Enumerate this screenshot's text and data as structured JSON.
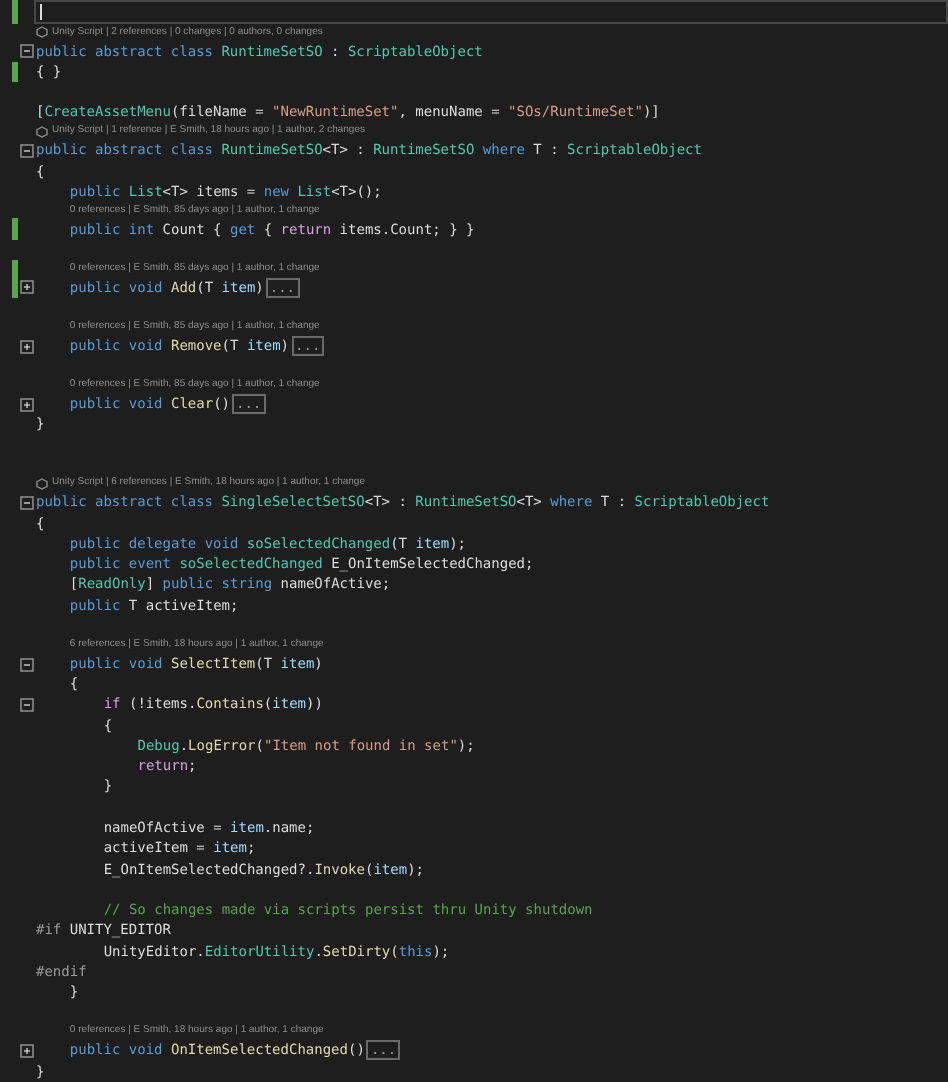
{
  "editor": {
    "lines": [
      {
        "kind": "cursor",
        "changed": true
      },
      {
        "kind": "lens",
        "unity_icon": true,
        "text": "Unity Script | 2 references | 0 changes | 0 authors, 0 changes"
      },
      {
        "kind": "code",
        "fold_marker": true,
        "expanded": true,
        "tokens": [
          {
            "text": "public abstract class ",
            "kind": "kw"
          },
          {
            "text": "RuntimeSetSO",
            "kind": "type"
          },
          {
            "text": " : ",
            "kind": "plain"
          },
          {
            "text": "ScriptableObject",
            "kind": "type"
          }
        ]
      },
      {
        "kind": "code",
        "changed": true,
        "tokens": [
          {
            "text": "{ }",
            "kind": "plain"
          }
        ]
      },
      {
        "kind": "blank"
      },
      {
        "kind": "code",
        "tokens": [
          {
            "text": "[",
            "kind": "plain"
          },
          {
            "text": "CreateAssetMenu",
            "kind": "type"
          },
          {
            "text": "(fileName = ",
            "kind": "plain"
          },
          {
            "text": "\"NewRuntimeSet\"",
            "kind": "str"
          },
          {
            "text": ", menuName = ",
            "kind": "plain"
          },
          {
            "text": "\"SOs/RuntimeSet\"",
            "kind": "str"
          },
          {
            "text": ")]",
            "kind": "plain"
          }
        ]
      },
      {
        "kind": "lens",
        "unity_icon": true,
        "text": "Unity Script | 1 reference | E Smith, 18 hours ago | 1 author, 2 changes"
      },
      {
        "kind": "code",
        "fold_marker": true,
        "expanded": true,
        "tokens": [
          {
            "text": "public abstract class ",
            "kind": "kw"
          },
          {
            "text": "RuntimeSetSO",
            "kind": "type"
          },
          {
            "text": "<T> : ",
            "kind": "plain"
          },
          {
            "text": "RuntimeSetSO",
            "kind": "type"
          },
          {
            "text": " where",
            "kind": "kw"
          },
          {
            "text": " T : ",
            "kind": "plain"
          },
          {
            "text": "ScriptableObject",
            "kind": "type"
          }
        ]
      },
      {
        "kind": "code",
        "tokens": [
          {
            "text": "{",
            "kind": "plain"
          }
        ]
      },
      {
        "kind": "code",
        "tokens": [
          {
            "text": "    public ",
            "kind": "kw"
          },
          {
            "text": "List",
            "kind": "type"
          },
          {
            "text": "<T> items = ",
            "kind": "plain"
          },
          {
            "text": "new ",
            "kind": "kw"
          },
          {
            "text": "List",
            "kind": "type"
          },
          {
            "text": "<T>();",
            "kind": "plain"
          }
        ]
      },
      {
        "kind": "lens",
        "text": "    0 references | E Smith, 85 days ago | 1 author, 1 change"
      },
      {
        "kind": "code",
        "changed": true,
        "tokens": [
          {
            "text": "    public int ",
            "kind": "kw"
          },
          {
            "text": "Count { ",
            "kind": "plain"
          },
          {
            "text": "get",
            "kind": "kw"
          },
          {
            "text": " { ",
            "kind": "plain"
          },
          {
            "text": "return",
            "kind": "ctrl"
          },
          {
            "text": " items.Count; } }",
            "kind": "plain"
          }
        ]
      },
      {
        "kind": "blank"
      },
      {
        "kind": "lens",
        "changed": true,
        "text": "    0 references | E Smith, 85 days ago | 1 author, 1 change"
      },
      {
        "kind": "code",
        "fold_marker": true,
        "expanded": false,
        "changed": true,
        "collapsed": "...",
        "tokens": [
          {
            "text": "    public void ",
            "kind": "kw"
          },
          {
            "text": "Add",
            "kind": "method"
          },
          {
            "text": "(T ",
            "kind": "plain"
          },
          {
            "text": "item",
            "kind": "param"
          },
          {
            "text": ")",
            "kind": "plain"
          }
        ]
      },
      {
        "kind": "blank"
      },
      {
        "kind": "lens",
        "text": "    0 references | E Smith, 85 days ago | 1 author, 1 change"
      },
      {
        "kind": "code",
        "fold_marker": true,
        "expanded": false,
        "collapsed": "...",
        "tokens": [
          {
            "text": "    public void ",
            "kind": "kw"
          },
          {
            "text": "Remove",
            "kind": "method"
          },
          {
            "text": "(T ",
            "kind": "plain"
          },
          {
            "text": "item",
            "kind": "param"
          },
          {
            "text": ")",
            "kind": "plain"
          }
        ]
      },
      {
        "kind": "blank"
      },
      {
        "kind": "lens",
        "text": "    0 references | E Smith, 85 days ago | 1 author, 1 change"
      },
      {
        "kind": "code",
        "fold_marker": true,
        "expanded": false,
        "collapsed": "...",
        "tokens": [
          {
            "text": "    public void ",
            "kind": "kw"
          },
          {
            "text": "Clear",
            "kind": "method"
          },
          {
            "text": "()",
            "kind": "plain"
          }
        ]
      },
      {
        "kind": "code",
        "tokens": [
          {
            "text": "}",
            "kind": "plain"
          }
        ]
      },
      {
        "kind": "blank"
      },
      {
        "kind": "blank"
      },
      {
        "kind": "lens",
        "unity_icon": true,
        "text": "Unity Script | 6 references | E Smith, 18 hours ago | 1 author, 1 change"
      },
      {
        "kind": "code",
        "fold_marker": true,
        "expanded": true,
        "tokens": [
          {
            "text": "public abstract class ",
            "kind": "kw"
          },
          {
            "text": "SingleSelectSetSO",
            "kind": "type"
          },
          {
            "text": "<T> : ",
            "kind": "plain"
          },
          {
            "text": "RuntimeSetSO",
            "kind": "type"
          },
          {
            "text": "<T> ",
            "kind": "plain"
          },
          {
            "text": "where",
            "kind": "kw"
          },
          {
            "text": " T : ",
            "kind": "plain"
          },
          {
            "text": "ScriptableObject",
            "kind": "type"
          }
        ]
      },
      {
        "kind": "code",
        "tokens": [
          {
            "text": "{",
            "kind": "plain"
          }
        ]
      },
      {
        "kind": "code",
        "tokens": [
          {
            "text": "    public delegate void ",
            "kind": "kw"
          },
          {
            "text": "soSelectedChanged",
            "kind": "type"
          },
          {
            "text": "(T ",
            "kind": "plain"
          },
          {
            "text": "item",
            "kind": "param"
          },
          {
            "text": ");",
            "kind": "plain"
          }
        ]
      },
      {
        "kind": "code",
        "tokens": [
          {
            "text": "    public event ",
            "kind": "kw"
          },
          {
            "text": "soSelectedChanged",
            "kind": "type"
          },
          {
            "text": " E_OnItemSelectedChanged;",
            "kind": "plain"
          }
        ]
      },
      {
        "kind": "code",
        "tokens": [
          {
            "text": "    [",
            "kind": "plain"
          },
          {
            "text": "ReadOnly",
            "kind": "type"
          },
          {
            "text": "] ",
            "kind": "plain"
          },
          {
            "text": "public string ",
            "kind": "kw"
          },
          {
            "text": "nameOfActive;",
            "kind": "plain"
          }
        ]
      },
      {
        "kind": "code",
        "tokens": [
          {
            "text": "    public ",
            "kind": "kw"
          },
          {
            "text": "T activeItem;",
            "kind": "plain"
          }
        ]
      },
      {
        "kind": "blank"
      },
      {
        "kind": "lens",
        "text": "    6 references | E Smith, 18 hours ago | 1 author, 1 change"
      },
      {
        "kind": "code",
        "fold_marker": true,
        "expanded": true,
        "tokens": [
          {
            "text": "    public void ",
            "kind": "kw"
          },
          {
            "text": "SelectItem",
            "kind": "method"
          },
          {
            "text": "(T ",
            "kind": "plain"
          },
          {
            "text": "item",
            "kind": "param"
          },
          {
            "text": ")",
            "kind": "plain"
          }
        ]
      },
      {
        "kind": "code",
        "tokens": [
          {
            "text": "    {",
            "kind": "plain"
          }
        ]
      },
      {
        "kind": "code",
        "fold_marker": true,
        "expanded": true,
        "tokens": [
          {
            "text": "        if",
            "kind": "ctrl"
          },
          {
            "text": " (!items.",
            "kind": "plain"
          },
          {
            "text": "Contains",
            "kind": "method"
          },
          {
            "text": "(",
            "kind": "plain"
          },
          {
            "text": "item",
            "kind": "param"
          },
          {
            "text": "))",
            "kind": "plain"
          }
        ]
      },
      {
        "kind": "code",
        "tokens": [
          {
            "text": "        {",
            "kind": "plain"
          }
        ]
      },
      {
        "kind": "code",
        "tokens": [
          {
            "text": "            Debug",
            "kind": "type"
          },
          {
            "text": ".",
            "kind": "plain"
          },
          {
            "text": "LogError",
            "kind": "method"
          },
          {
            "text": "(",
            "kind": "plain"
          },
          {
            "text": "\"Item not found in set\"",
            "kind": "str"
          },
          {
            "text": ");",
            "kind": "plain"
          }
        ]
      },
      {
        "kind": "code",
        "tokens": [
          {
            "text": "            return",
            "kind": "ctrl"
          },
          {
            "text": ";",
            "kind": "plain"
          }
        ]
      },
      {
        "kind": "code",
        "tokens": [
          {
            "text": "        }",
            "kind": "plain"
          }
        ]
      },
      {
        "kind": "blank"
      },
      {
        "kind": "code",
        "tokens": [
          {
            "text": "        nameOfActive = ",
            "kind": "plain"
          },
          {
            "text": "item",
            "kind": "param"
          },
          {
            "text": ".name;",
            "kind": "plain"
          }
        ]
      },
      {
        "kind": "code",
        "tokens": [
          {
            "text": "        activeItem = ",
            "kind": "plain"
          },
          {
            "text": "item",
            "kind": "param"
          },
          {
            "text": ";",
            "kind": "plain"
          }
        ]
      },
      {
        "kind": "code",
        "tokens": [
          {
            "text": "        E_OnItemSelectedChanged?.",
            "kind": "plain"
          },
          {
            "text": "Invoke",
            "kind": "method"
          },
          {
            "text": "(",
            "kind": "plain"
          },
          {
            "text": "item",
            "kind": "param"
          },
          {
            "text": ");",
            "kind": "plain"
          }
        ]
      },
      {
        "kind": "blank"
      },
      {
        "kind": "code",
        "tokens": [
          {
            "text": "        // So changes made via scripts persist thru Unity shutdown",
            "kind": "comment"
          }
        ]
      },
      {
        "kind": "code",
        "tokens": [
          {
            "text": "#if ",
            "kind": "pre"
          },
          {
            "text": "UNITY_EDITOR",
            "kind": "plain"
          }
        ]
      },
      {
        "kind": "code",
        "tokens": [
          {
            "text": "        UnityEditor.",
            "kind": "plain"
          },
          {
            "text": "EditorUtility",
            "kind": "type"
          },
          {
            "text": ".",
            "kind": "plain"
          },
          {
            "text": "SetDirty",
            "kind": "method"
          },
          {
            "text": "(",
            "kind": "plain"
          },
          {
            "text": "this",
            "kind": "kw"
          },
          {
            "text": ");",
            "kind": "plain"
          }
        ]
      },
      {
        "kind": "code",
        "tokens": [
          {
            "text": "#endif",
            "kind": "pre"
          }
        ]
      },
      {
        "kind": "code",
        "tokens": [
          {
            "text": "    }",
            "kind": "plain"
          }
        ]
      },
      {
        "kind": "blank"
      },
      {
        "kind": "lens",
        "text": "    0 references | E Smith, 18 hours ago | 1 author, 1 change"
      },
      {
        "kind": "code",
        "fold_marker": true,
        "expanded": false,
        "collapsed": "...",
        "tokens": [
          {
            "text": "    public void ",
            "kind": "kw"
          },
          {
            "text": "OnItemSelectedChanged",
            "kind": "method"
          },
          {
            "text": "()",
            "kind": "plain"
          }
        ]
      },
      {
        "kind": "code",
        "tokens": [
          {
            "text": "}",
            "kind": "plain"
          }
        ]
      }
    ]
  }
}
